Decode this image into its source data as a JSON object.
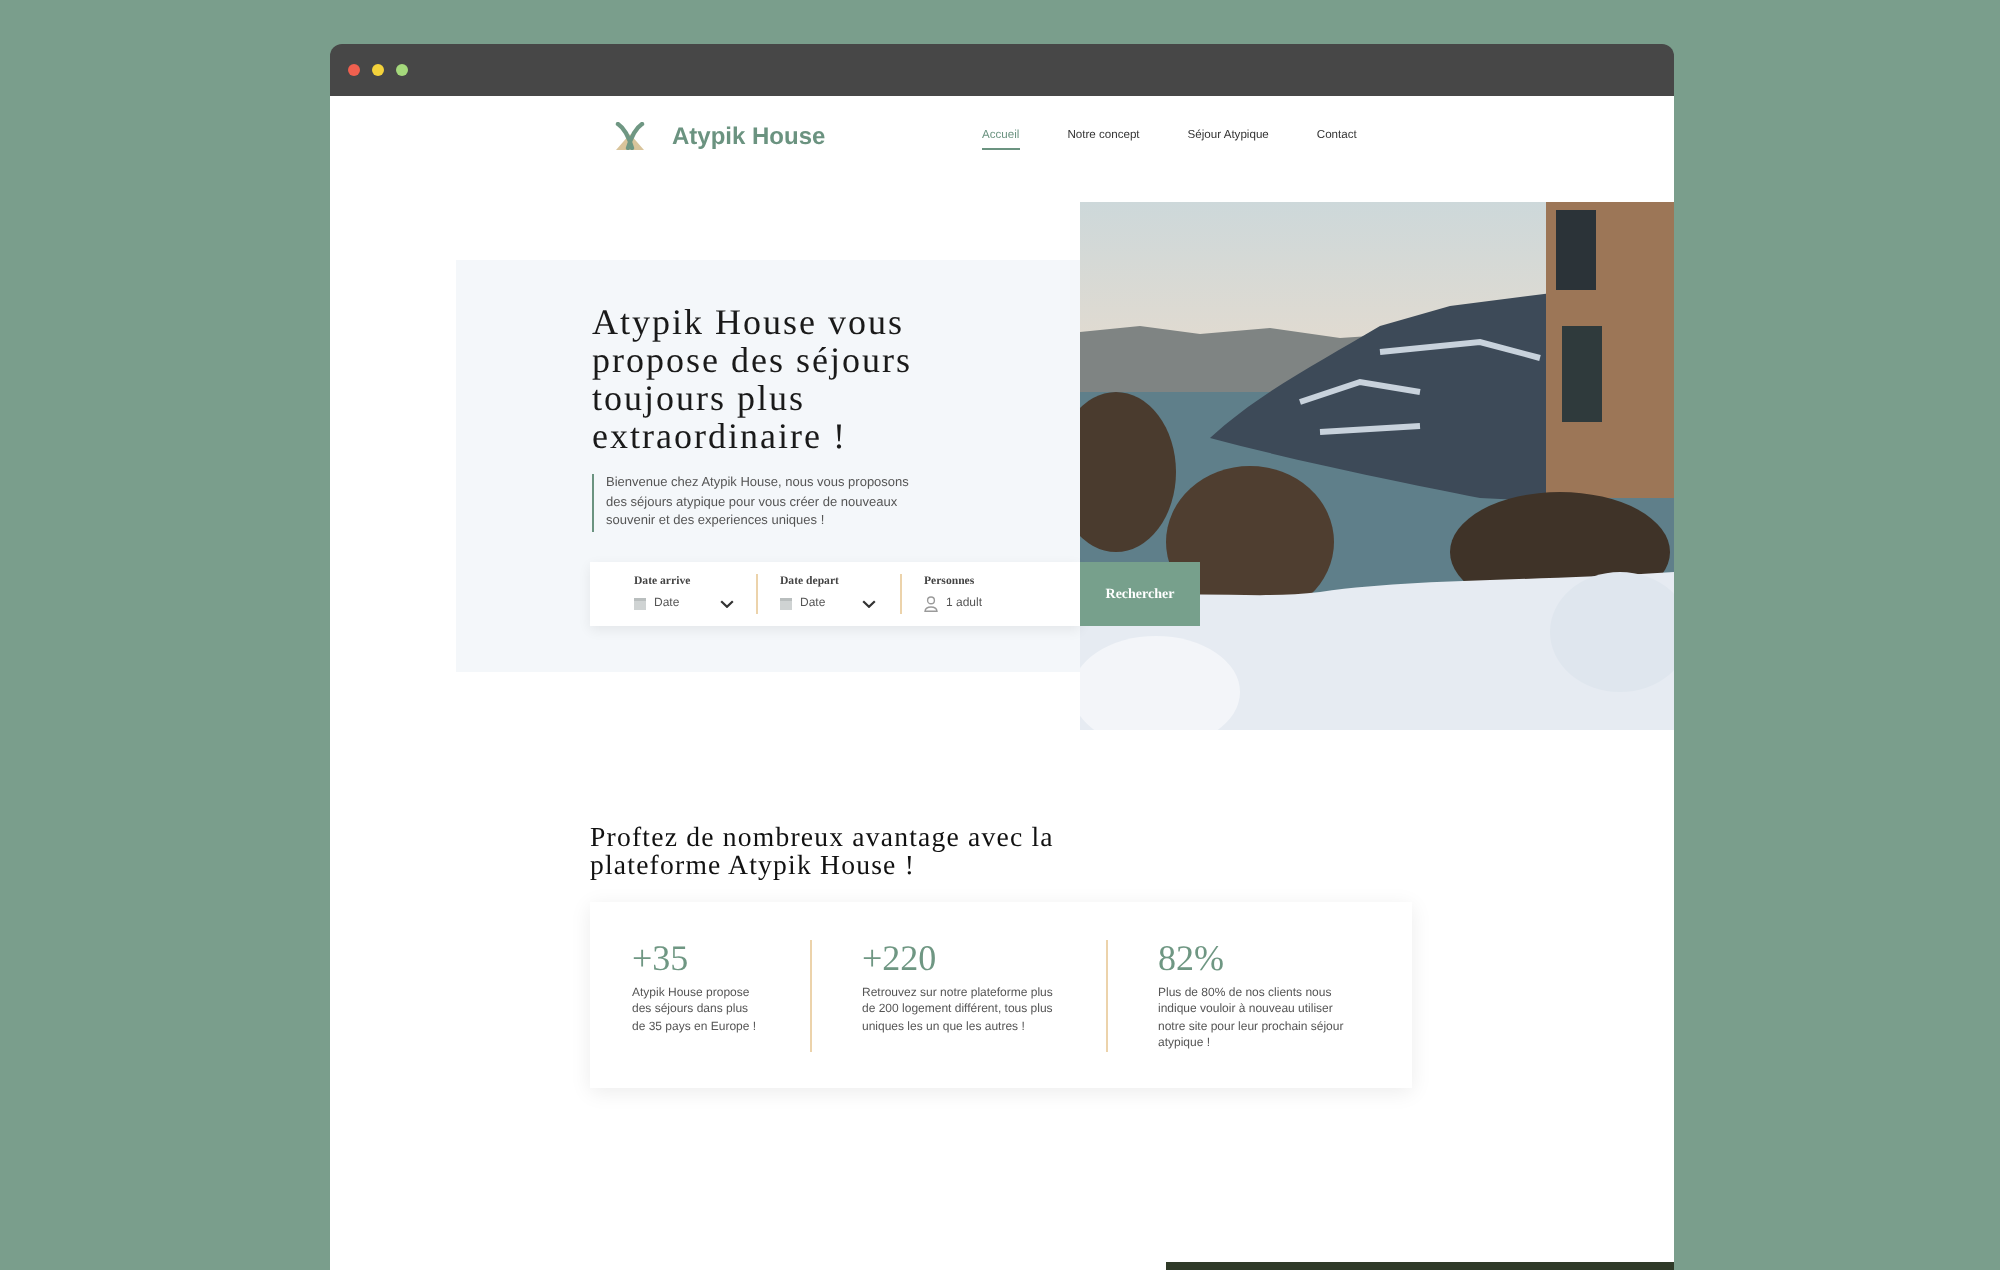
{
  "header": {
    "logo_text": "Atypik House",
    "nav": [
      {
        "label": "Accueil",
        "selected": true
      },
      {
        "label": "Notre concept",
        "selected": false
      },
      {
        "label": "Séjour Atypique",
        "selected": false
      },
      {
        "label": "Contact",
        "selected": false
      }
    ]
  },
  "hero": {
    "title": "Atypik House vous propose des séjours toujours plus extraordinaire !",
    "intro": "Bienvenue chez Atypik House, nous vous proposons des séjours atypique pour vous créer de nouveaux souvenir et des experiences uniques !",
    "search": {
      "fields": [
        {
          "kind": "date",
          "label": "Date arrive",
          "value": "Date"
        },
        {
          "kind": "date",
          "label": "Date depart",
          "value": "Date"
        },
        {
          "kind": "guests",
          "label": "Personnes",
          "value": "1 adult"
        }
      ],
      "button": "Rechercher"
    }
  },
  "advantages": {
    "title": "Proftez de nombreux avantage avec la plateforme Atypik House !",
    "stats": [
      {
        "value": "+35",
        "text": "Atypik House propose des séjours dans plus de 35 pays en Europe !"
      },
      {
        "value": "+220",
        "text": "Retrouvez sur notre plateforme plus de 200 logement différent, tous plus uniques les un que les autres !"
      },
      {
        "value": "82%",
        "text": "Plus de 80% de nos clients nous indique vouloir à nouveau utiliser notre site pour leur prochain séjour atypique !"
      }
    ]
  }
}
